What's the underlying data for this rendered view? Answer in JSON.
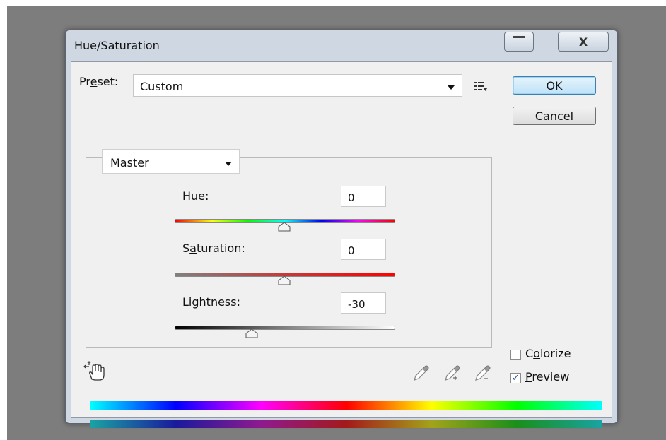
{
  "dialog": {
    "title": "Hue/Saturation",
    "close_glyph": "X"
  },
  "preset": {
    "label_before": "Pr",
    "label_underline": "e",
    "label_after": "set:",
    "value": "Custom"
  },
  "buttons": {
    "ok": "OK",
    "cancel": "Cancel"
  },
  "channel": {
    "value": "Master"
  },
  "sliders": {
    "hue": {
      "ul": "H",
      "rest": "ue:",
      "value": "0",
      "position": 0.5
    },
    "saturation": {
      "pre": "S",
      "ul": "a",
      "rest": "turation:",
      "value": "0",
      "position": 0.5
    },
    "lightness": {
      "pre": "L",
      "ul": "i",
      "rest": "ghtness:",
      "value": "-30",
      "position": 0.35
    }
  },
  "options": {
    "colorize": {
      "pre": "C",
      "ul": "o",
      "rest": "lorize",
      "checked": false
    },
    "preview": {
      "ul": "P",
      "rest": "review",
      "checked": true,
      "check_glyph": "✓"
    }
  },
  "icons": {
    "targeted_adjustment": "hand-adjust-icon",
    "eyedropper": "eyedropper-icon",
    "eyedropper_add": "eyedropper-plus-icon",
    "eyedropper_subtract": "eyedropper-minus-icon",
    "preset_menu": "preset-options-icon"
  },
  "colors": {
    "ok_border": "#3c7fb1",
    "checkmark": "#1d4fa0"
  }
}
